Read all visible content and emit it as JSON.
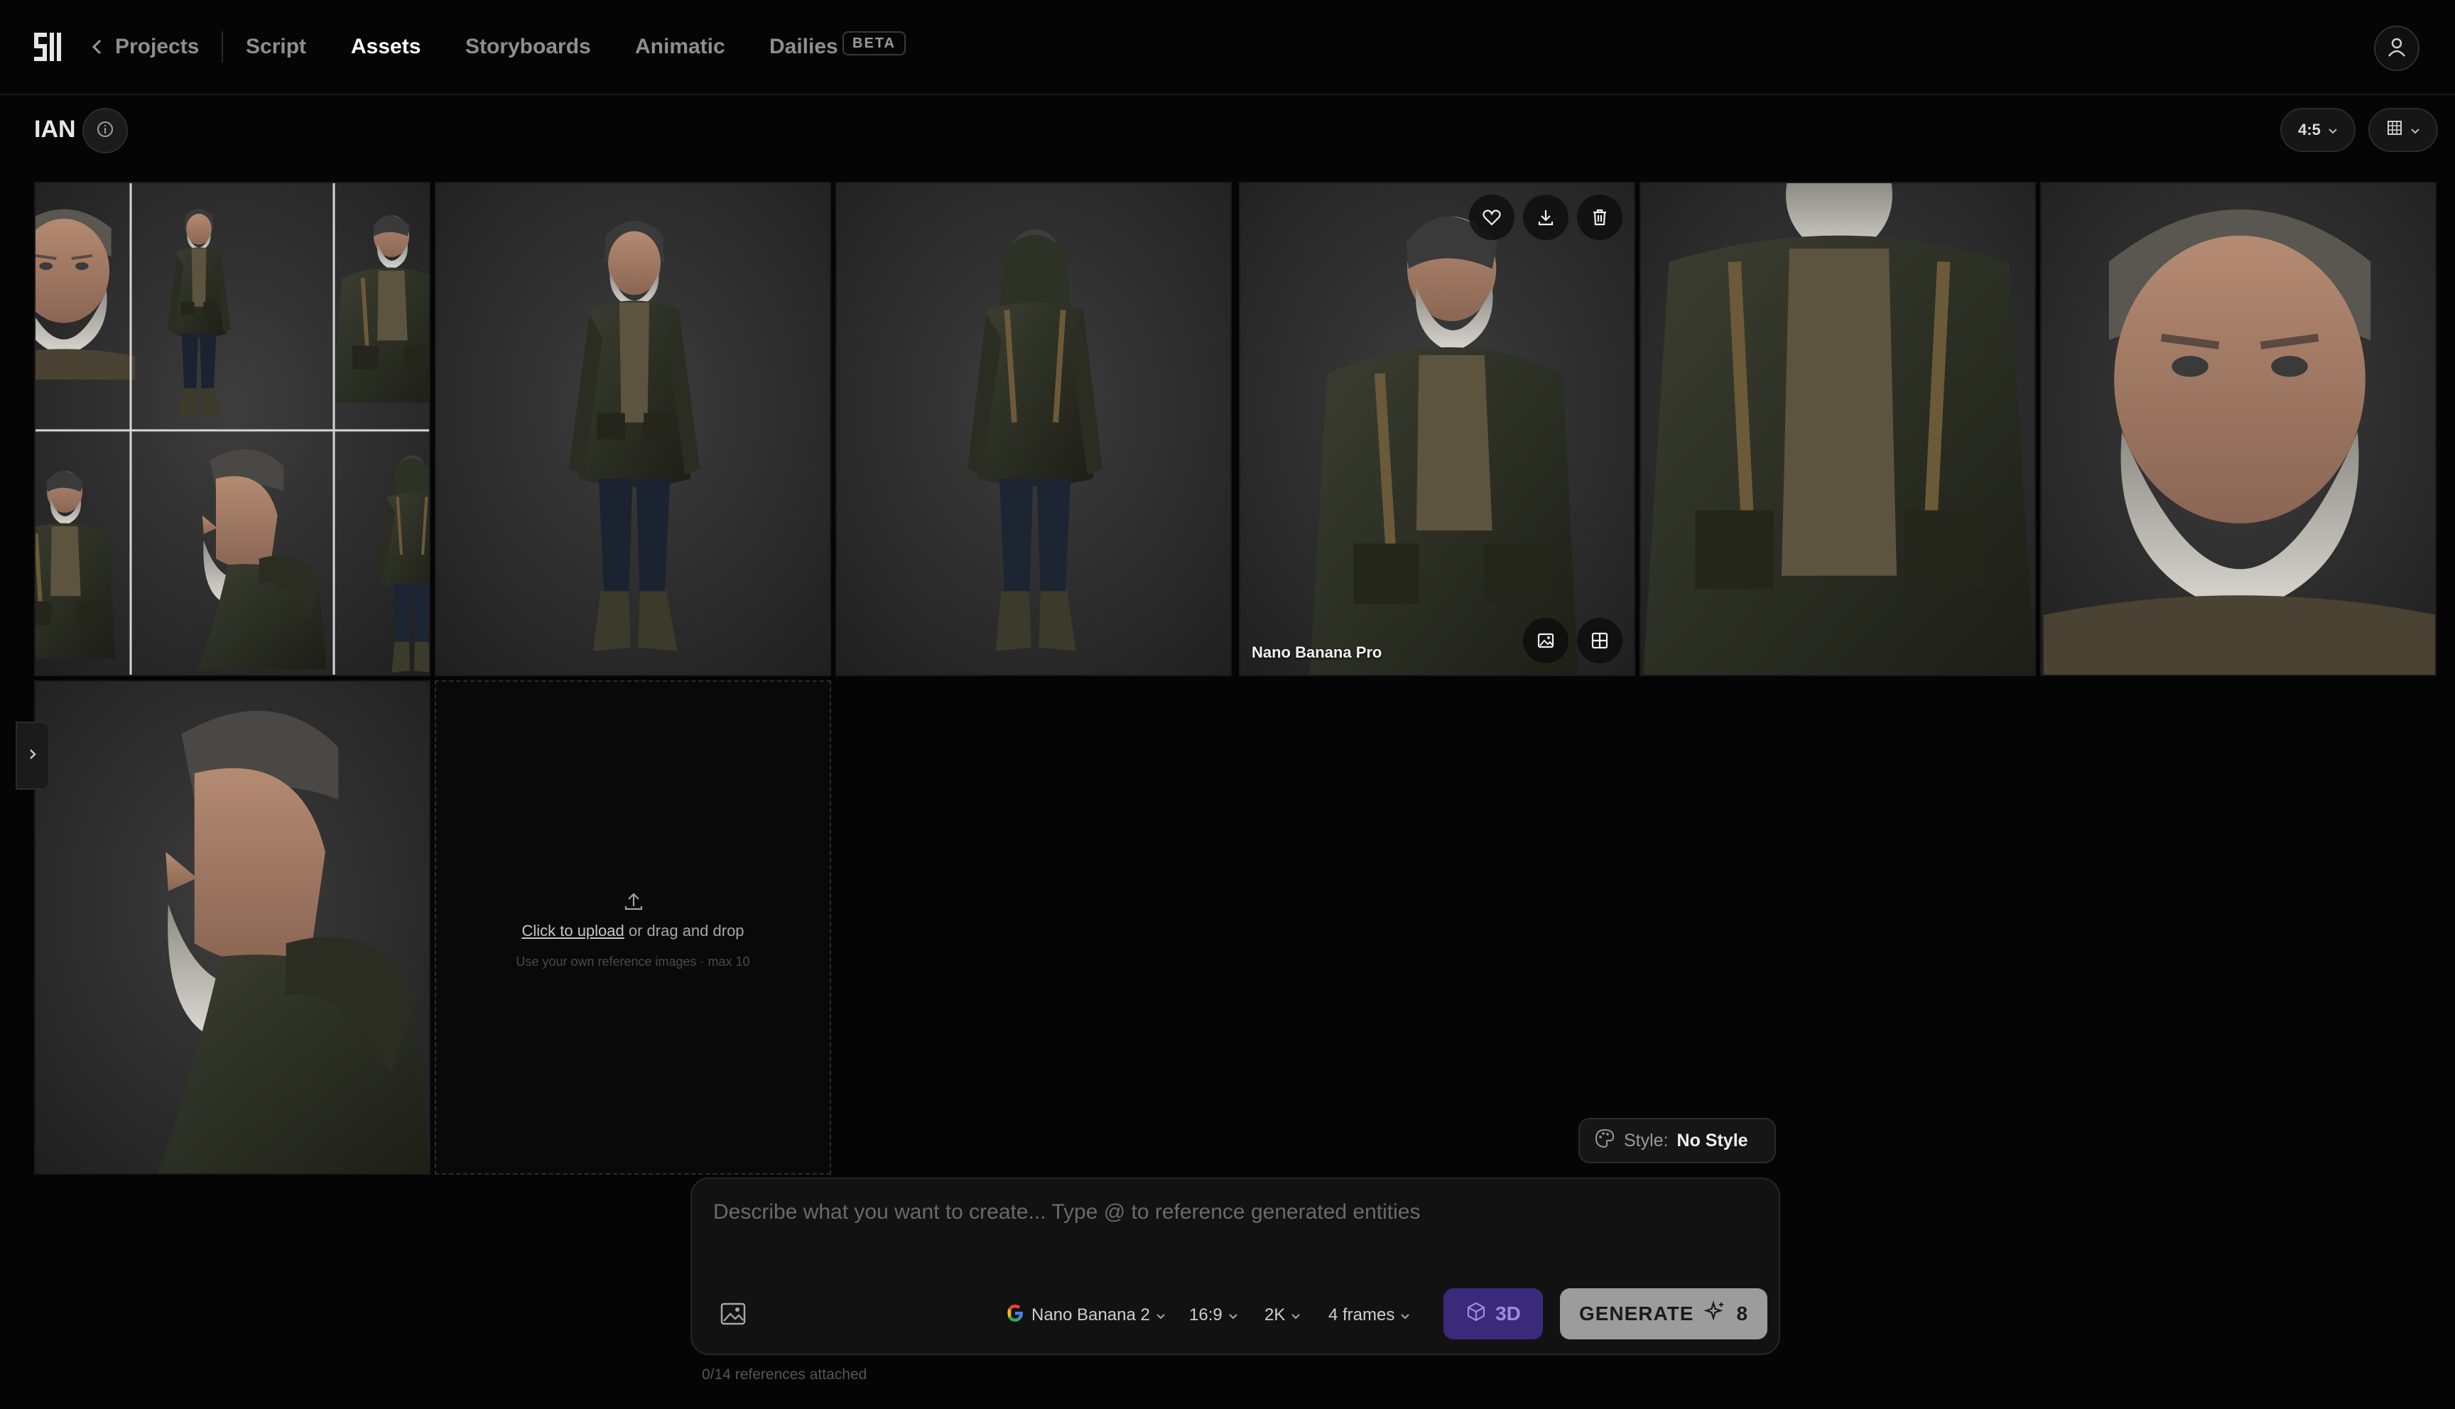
{
  "nav": {
    "back_label": "Projects",
    "items": [
      {
        "label": "Script",
        "active": false
      },
      {
        "label": "Assets",
        "active": true
      },
      {
        "label": "Storyboards",
        "active": false
      },
      {
        "label": "Animatic",
        "active": false
      },
      {
        "label": "Dailies",
        "active": false
      }
    ],
    "beta_badge": "BETA"
  },
  "entity": {
    "title": "IAN"
  },
  "view_controls": {
    "aspect_ratio": "4:5"
  },
  "gallery": {
    "hovered_model_label": "Nano Banana Pro",
    "images": [
      {
        "view": "contact-sheet"
      },
      {
        "view": "full-body-front"
      },
      {
        "view": "full-body-back"
      },
      {
        "view": "three-quarter"
      },
      {
        "view": "torso-closeup"
      },
      {
        "view": "face-portrait"
      },
      {
        "view": "profile"
      }
    ]
  },
  "upload": {
    "link_text": "Click to upload",
    "rest_text": " or drag and drop",
    "hint": "Use your own reference images · max 10"
  },
  "style": {
    "label": "Style:",
    "value": "No Style"
  },
  "composer": {
    "placeholder": "Describe what you want to create... Type @ to reference generated entities",
    "model": "Nano Banana 2",
    "ratio": "16:9",
    "resolution": "2K",
    "frames": "4 frames",
    "btn_3d": "3D",
    "generate_label": "GENERATE",
    "credits": "8",
    "references_note": "0/14 references attached"
  },
  "colors": {
    "background": "#050505",
    "accent_3d": "#3a2a7a",
    "generate_button": "#9c9c9c",
    "backdrop": "#2e2e2e",
    "jacket": "#2f3226",
    "sweater": "#5d5440",
    "skin": "#a37c67",
    "beard": "#cfcac3"
  },
  "icons": [
    "logo-icon",
    "chevron-left-icon",
    "user-icon",
    "info-icon",
    "chevron-down-icon",
    "grid-icon",
    "heart-icon",
    "download-icon",
    "trash-icon",
    "image-icon",
    "split-grid-icon",
    "upload-icon",
    "chevron-right-icon",
    "palette-icon",
    "google-icon",
    "cube-icon",
    "sparkle-icon"
  ]
}
